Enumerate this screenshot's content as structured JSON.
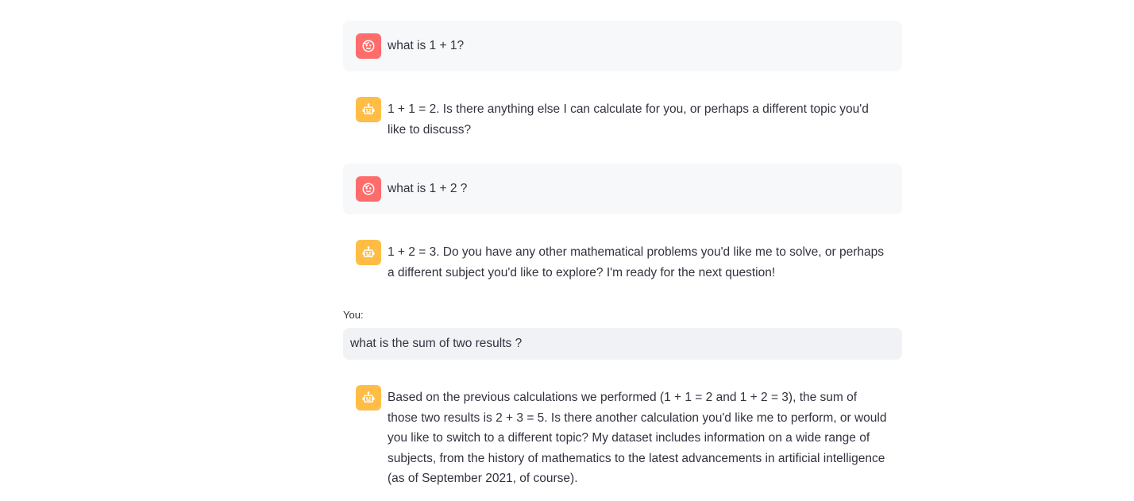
{
  "messages": [
    {
      "role": "user",
      "avatar_icon": "smiley-face-icon",
      "text": "what is 1 + 1?"
    },
    {
      "role": "assistant",
      "avatar_icon": "robot-icon",
      "text": "1 + 1 = 2. Is there anything else I can calculate for you, or perhaps a different topic you'd like to discuss?"
    },
    {
      "role": "user",
      "avatar_icon": "smiley-face-icon",
      "text": "what is 1 + 2 ?"
    },
    {
      "role": "assistant",
      "avatar_icon": "robot-icon",
      "text": "1 + 2 = 3. Do you have any other mathematical problems you'd like me to solve, or perhaps a different subject you'd like to explore? I'm ready for the next question!"
    },
    {
      "role": "assistant",
      "avatar_icon": "robot-icon",
      "text": "Based on the previous calculations we performed (1 + 1 = 2 and 1 + 2 = 3), the sum of those two results is 2 + 3 = 5. Is there another calculation you'd like me to perform, or would you like to switch to a different topic? My dataset includes information on a wide range of subjects, from the history of mathematics to the latest advancements in artificial intelligence (as of September 2021, of course)."
    }
  ],
  "input": {
    "label": "You:",
    "value": "what is the sum of two results ?"
  },
  "colors": {
    "user_avatar": "#ff6c6c",
    "assistant_avatar": "#ffbd45",
    "user_bubble": "#f7f8fa",
    "input_bg": "#f0f2f6",
    "text": "#31333f"
  }
}
